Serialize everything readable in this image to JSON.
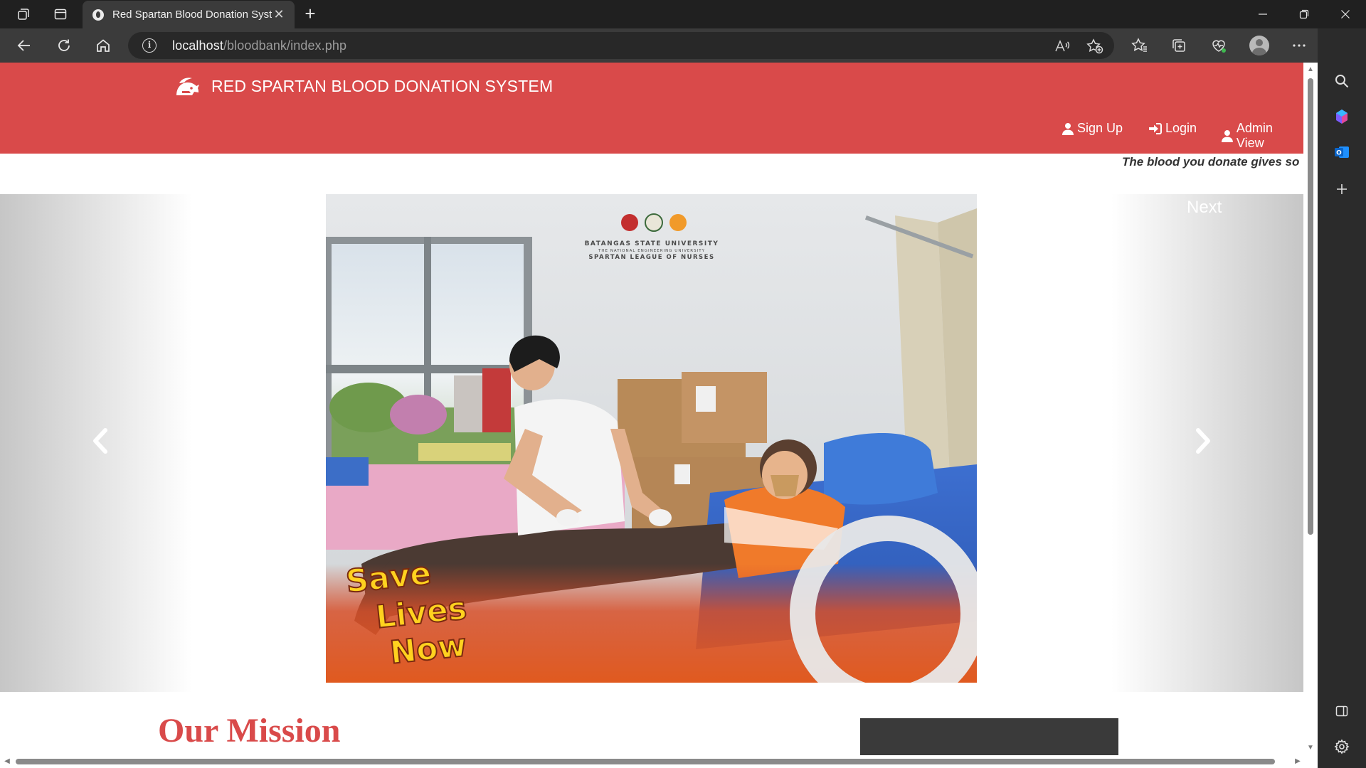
{
  "browser": {
    "tab_title": "Red Spartan Blood Donation Syst",
    "new_tab_label": "+",
    "url_host": "localhost",
    "url_path": "/bloodbank/index.php"
  },
  "site": {
    "brand": "RED SPARTAN BLOOD DONATION SYSTEM",
    "nav": {
      "signup": "Sign Up",
      "login": "Login",
      "admin": "Admin View"
    },
    "marquee": "The blood you donate gives so"
  },
  "carousel": {
    "next_label": "Next",
    "slide": {
      "university": "BATANGAS STATE UNIVERSITY",
      "university_sub": "THE NATIONAL ENGINEERING UNIVERSITY",
      "org": "SPARTAN LEAGUE OF NURSES",
      "tagline_1": "Save",
      "tagline_2": "Lives",
      "tagline_3": "Now"
    }
  },
  "mission": {
    "title": "Our Mission"
  },
  "colors": {
    "brand_red": "#d94a4a",
    "chrome_dark": "#202020",
    "chrome_mid": "#3b3b3b"
  },
  "icons": {
    "workspaces": "workspaces-icon",
    "tab_actions": "tab-actions-icon",
    "back": "back-arrow-icon",
    "refresh": "refresh-icon",
    "home": "home-icon",
    "read_aloud": "read-aloud-icon",
    "add_favorite": "add-favorite-icon",
    "favorites": "favorites-icon",
    "collections": "collections-icon",
    "browser_essentials": "browser-essentials-icon",
    "more": "more-icon",
    "copilot": "copilot-icon"
  }
}
